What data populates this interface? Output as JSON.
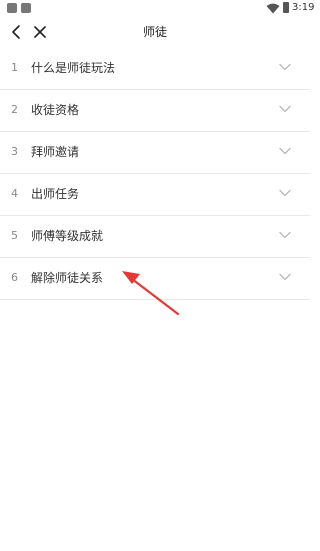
{
  "status_bar": {
    "time": "3:19",
    "icons": [
      "app-icon",
      "app-icon",
      "wifi-icon",
      "battery-icon"
    ]
  },
  "header": {
    "title": "师徒",
    "back_icon": "chevron-left-icon",
    "close_icon": "close-icon"
  },
  "items": [
    {
      "number": "1",
      "label": "什么是师徒玩法"
    },
    {
      "number": "2",
      "label": "收徒资格"
    },
    {
      "number": "3",
      "label": "拜师邀请"
    },
    {
      "number": "4",
      "label": "出师任务"
    },
    {
      "number": "5",
      "label": "师傅等级成就"
    },
    {
      "number": "6",
      "label": "解除师徒关系"
    }
  ],
  "expand_icon": "chevron-down-icon",
  "colors": {
    "text": "#333333",
    "muted": "#888888",
    "divider": "#e8e8e8",
    "annotation": "#e53935"
  }
}
